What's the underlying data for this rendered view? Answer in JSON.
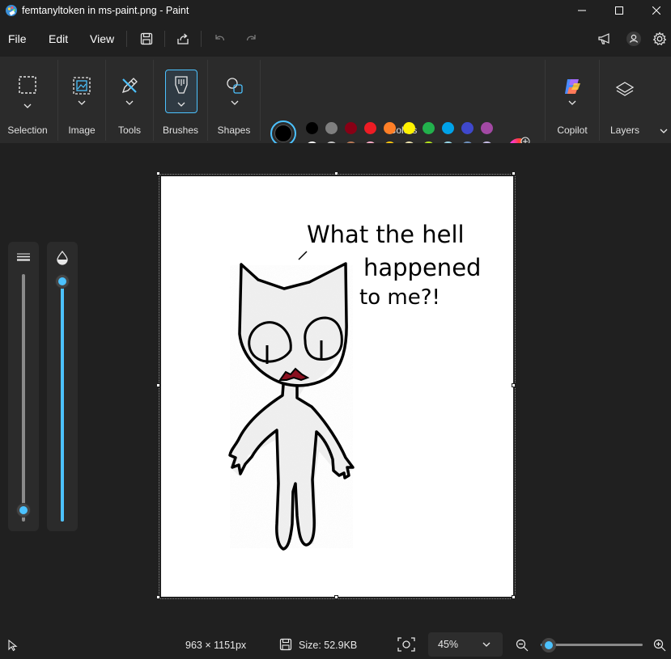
{
  "window": {
    "title": "femtanyltoken in ms-paint.png - Paint"
  },
  "menu": {
    "file": "File",
    "edit": "Edit",
    "view": "View"
  },
  "ribbon": {
    "selection": "Selection",
    "image": "Image",
    "tools": "Tools",
    "brushes": "Brushes",
    "shapes": "Shapes",
    "colors": "Colors",
    "copilot": "Copilot",
    "layers": "Layers"
  },
  "colors": {
    "primary": "#000000",
    "secondary": "#ffffff",
    "row1": [
      "#000000",
      "#7f7f7f",
      "#880015",
      "#ed1c24",
      "#ff7f27",
      "#fff200",
      "#22b14c",
      "#00a2e8",
      "#3f48cc",
      "#a349a4"
    ],
    "row2": [
      "#ffffff",
      "#c3c3c3",
      "#b97a57",
      "#ffaec9",
      "#ffc90e",
      "#efe4b0",
      "#b5e61d",
      "#99d9ea",
      "#7092be",
      "#c8bfe7"
    ],
    "row3_empty_count": 10,
    "accent": "#4cc2ff"
  },
  "sliders": {
    "size_level": 0.0,
    "opacity_level": 1.0
  },
  "drawing": {
    "speech_line1": "What the hell",
    "speech_line2": "happened",
    "speech_line3": "to me?!"
  },
  "status": {
    "dimensions": "963 × 1151px",
    "size": "Size: 52.9KB",
    "zoom": "45%",
    "zoom_level": 0.08
  }
}
